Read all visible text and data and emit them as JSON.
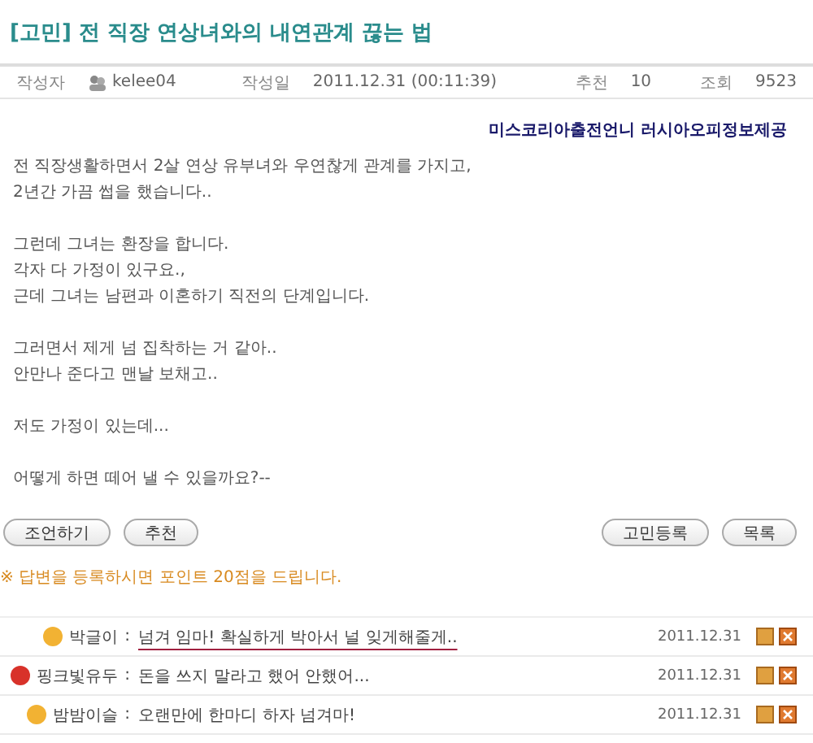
{
  "post": {
    "title": "[고민] 전 직장 연상녀와의 내연관계 끊는 법",
    "meta": [
      {
        "label": "작성자",
        "value": "kelee04",
        "kind": "user"
      },
      {
        "label": "작성일",
        "value": "2011.12.31 (00:11:39)",
        "kind": "text"
      },
      {
        "label": "추천",
        "value": "10",
        "kind": "text"
      },
      {
        "label": "조회",
        "value": "9523",
        "kind": "text"
      }
    ],
    "sponsor_link": "미스코리아출전언니 러시아오피정보제공",
    "body": [
      [
        "전 직장생활하면서 2살 연상 유부녀와 우연찮게 관계를 가지고,",
        "2년간 가끔 썹을 했습니다.."
      ],
      [
        "그런데 그녀는 환장을 합니다.",
        "각자 다 가정이 있구요.,",
        "근데 그녀는 남편과 이혼하기 직전의 단계입니다."
      ],
      [
        "그러면서 제게 넘 집착하는 거 같아..",
        "안만나 준다고 맨날 보채고.."
      ],
      [
        "저도 가정이 있는데..."
      ],
      [
        "어떻게 하면 떼어 낼 수 있을까요?--"
      ]
    ]
  },
  "buttons_left": [
    "조언하기",
    "추천"
  ],
  "buttons_right": [
    "고민등록",
    "목록"
  ],
  "notice": "※ 답변을 등록하시면 포인트 20점을 드립니다.",
  "comments": [
    {
      "author": "박글이",
      "separator": ":",
      "text": "넘겨 임마! 확실하게 박아서 널 잊게해줄게..",
      "date": "2011.12.31",
      "color": "#f2b233",
      "underlined": true
    },
    {
      "author": "핑크빛유두",
      "separator": ":",
      "text": "돈을 쓰지 말라고 했어 안했어...",
      "date": "2011.12.31",
      "color": "#d8322a",
      "underlined": false
    },
    {
      "author": "밤밤이슬",
      "separator": ":",
      "text": "오랜만에 한마디 하자 넘겨마!",
      "date": "2011.12.31",
      "color": "#f2b233",
      "underlined": false
    }
  ]
}
